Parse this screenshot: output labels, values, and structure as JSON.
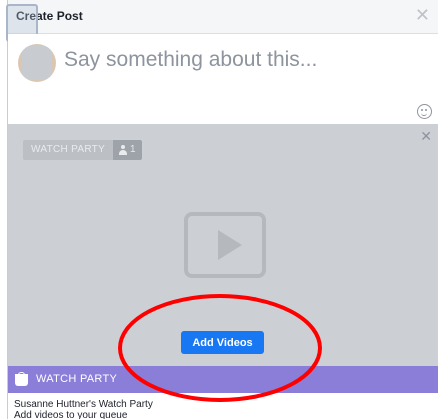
{
  "header": {
    "title": "Create Post",
    "close_glyph": "✕"
  },
  "composer": {
    "placeholder": "Say something about this...",
    "emoji_icon": "smiley-icon"
  },
  "stage": {
    "close_glyph": "✕",
    "badge_label": "WATCH PARTY",
    "viewer_count": "1",
    "add_button_label": "Add Videos"
  },
  "footer": {
    "section_title": "WATCH PARTY",
    "party_name": "Susanne Huttner's Watch Party",
    "hint": "Add videos to your queue"
  },
  "colors": {
    "accent_button": "#1877f2",
    "watch_party_bar": "#8b7ed8",
    "annotation": "#ff0000"
  }
}
